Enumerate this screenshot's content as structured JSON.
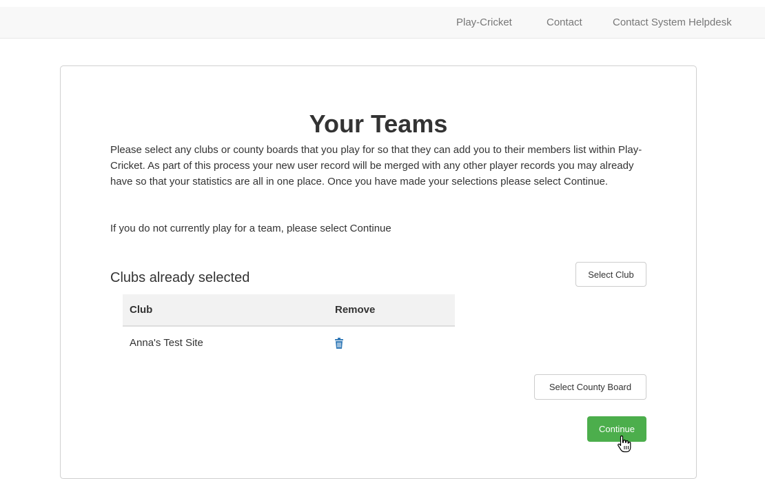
{
  "nav": {
    "play_cricket": "Play-Cricket",
    "contact": "Contact",
    "helpdesk": "Contact System Helpdesk"
  },
  "page": {
    "title": "Your Teams",
    "intro": "Please select any clubs or county boards that you play for so that they can add you to their members list within Play-Cricket. As part of this process your new user record will be merged with any other player records you may already have so that your statistics are all in one place. Once you have made your selections please select Continue.",
    "intro2": "If you do not currently play for a team, please select Continue"
  },
  "clubs": {
    "section_title": "Clubs already selected",
    "select_button": "Select Club",
    "columns": [
      "Club",
      "Remove"
    ],
    "rows": [
      {
        "club": "Anna's Test Site",
        "remove_icon": "trash-icon"
      }
    ]
  },
  "actions": {
    "select_county_board": "Select County Board",
    "continue": "Continue"
  },
  "colors": {
    "accent_green": "#4cae4c",
    "link_blue": "#337ab7"
  }
}
